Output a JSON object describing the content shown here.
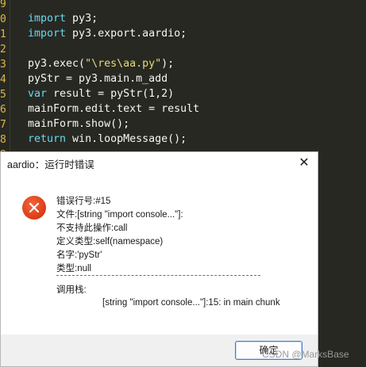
{
  "editor": {
    "line_numbers": [
      "9",
      "0",
      "1",
      "2",
      "3",
      "4",
      "5",
      "6",
      "7",
      "8",
      "9"
    ],
    "lines": [
      [
        {
          "t": "import",
          "c": "kw"
        },
        {
          "t": " py3;",
          "c": ""
        }
      ],
      [
        {
          "t": "import",
          "c": "kw"
        },
        {
          "t": " py3.export.aardio;",
          "c": ""
        }
      ],
      [],
      [
        {
          "t": "py3.exec(",
          "c": ""
        },
        {
          "t": "\"\\res\\aa.py\"",
          "c": "str"
        },
        {
          "t": ");",
          "c": ""
        }
      ],
      [
        {
          "t": "pyStr = py3.main.m_add",
          "c": ""
        }
      ],
      [
        {
          "t": "var",
          "c": "kw"
        },
        {
          "t": " result = pyStr(1,2)",
          "c": ""
        }
      ],
      [
        {
          "t": "mainForm.edit.text = result",
          "c": ""
        }
      ],
      [
        {
          "t": "mainForm.show();",
          "c": ""
        }
      ],
      [
        {
          "t": "return",
          "c": "kw"
        },
        {
          "t": " win.loopMessage();",
          "c": ""
        }
      ]
    ]
  },
  "dialog": {
    "title": "aardio：运行时错误",
    "close_glyph": "✕",
    "messages": [
      "错误行号:#15",
      "文件:[string \"import console...\"]:",
      "不支持此操作:call",
      "定义类型:self(namespace)",
      "名字:'pyStr'",
      "类型:null"
    ],
    "stack_label": "调用栈:",
    "stack_entry": "[string \"import console...\"]:15: in main chunk",
    "ok_label": "确定"
  },
  "watermark": "CSDN @MarksBase",
  "colors": {
    "editor_bg": "#272822",
    "keyword": "#66d9ef",
    "string": "#e6db74",
    "line_number": "#e0b84a",
    "error_icon": "#dc3b16",
    "ok_border": "#3a7ed0"
  }
}
